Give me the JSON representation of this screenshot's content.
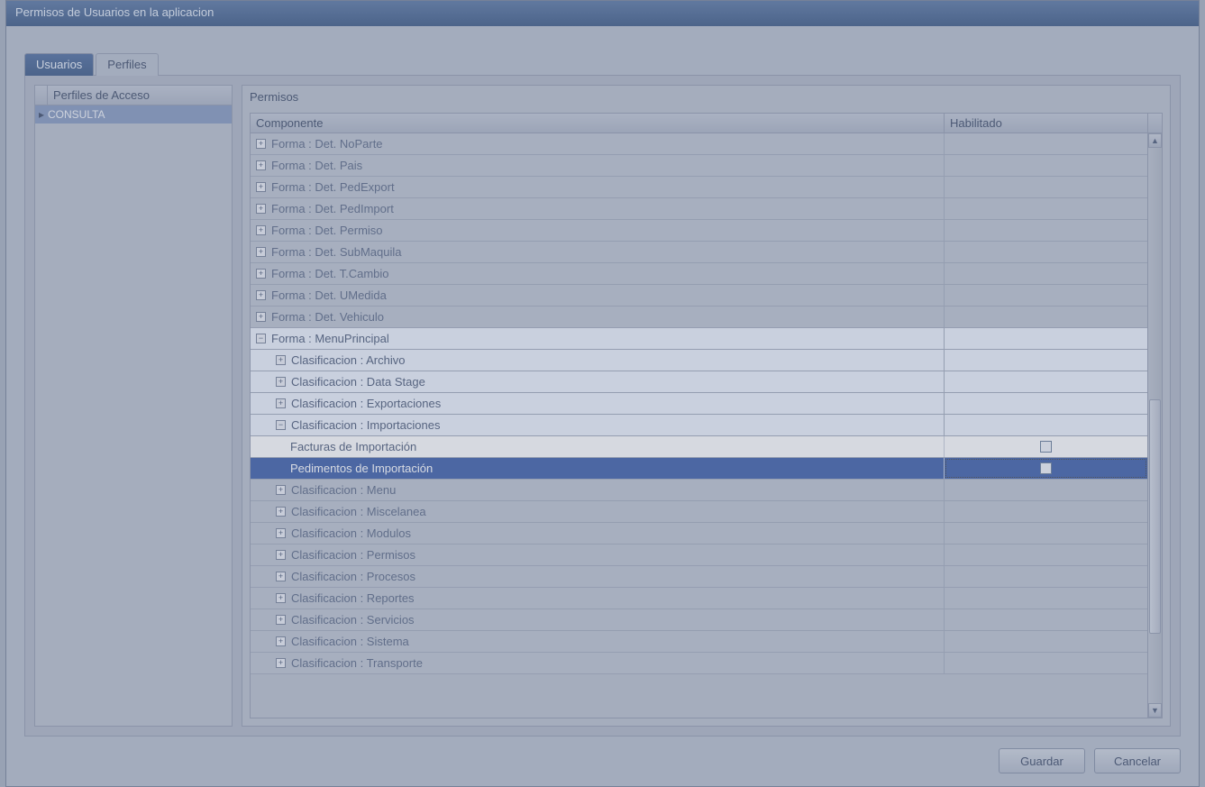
{
  "window": {
    "title": "Permisos de Usuarios en la aplicacion"
  },
  "tabs": {
    "usuarios": "Usuarios",
    "perfiles": "Perfiles"
  },
  "left": {
    "header": "Perfiles de Acceso",
    "selected": "CONSULTA"
  },
  "right": {
    "title": "Permisos",
    "col_componente": "Componente",
    "col_habilitado": "Habilitado"
  },
  "rows": {
    "r1": "Forma : Det. NoParte",
    "r2": "Forma : Det. Pais",
    "r3": "Forma : Det. PedExport",
    "r4": "Forma : Det. PedImport",
    "r5": "Forma : Det. Permiso",
    "r6": "Forma : Det. SubMaquila",
    "r7": "Forma : Det. T.Cambio",
    "r8": "Forma : Det. UMedida",
    "r9": "Forma : Det. Vehiculo",
    "r10": "Forma : MenuPrincipal",
    "r11": "Clasificacion : Archivo",
    "r12": "Clasificacion : Data Stage",
    "r13": "Clasificacion : Exportaciones",
    "r14": "Clasificacion : Importaciones",
    "r15": "Facturas de Importación",
    "r16": "Pedimentos de Importación",
    "r17": "Clasificacion : Menu",
    "r18": "Clasificacion : Miscelanea",
    "r19": "Clasificacion : Modulos",
    "r20": "Clasificacion : Permisos",
    "r21": "Clasificacion : Procesos",
    "r22": "Clasificacion : Reportes",
    "r23": "Clasificacion : Servicios",
    "r24": "Clasificacion : Sistema",
    "r25": "Clasificacion : Transporte"
  },
  "buttons": {
    "save": "Guardar",
    "cancel": "Cancelar"
  }
}
